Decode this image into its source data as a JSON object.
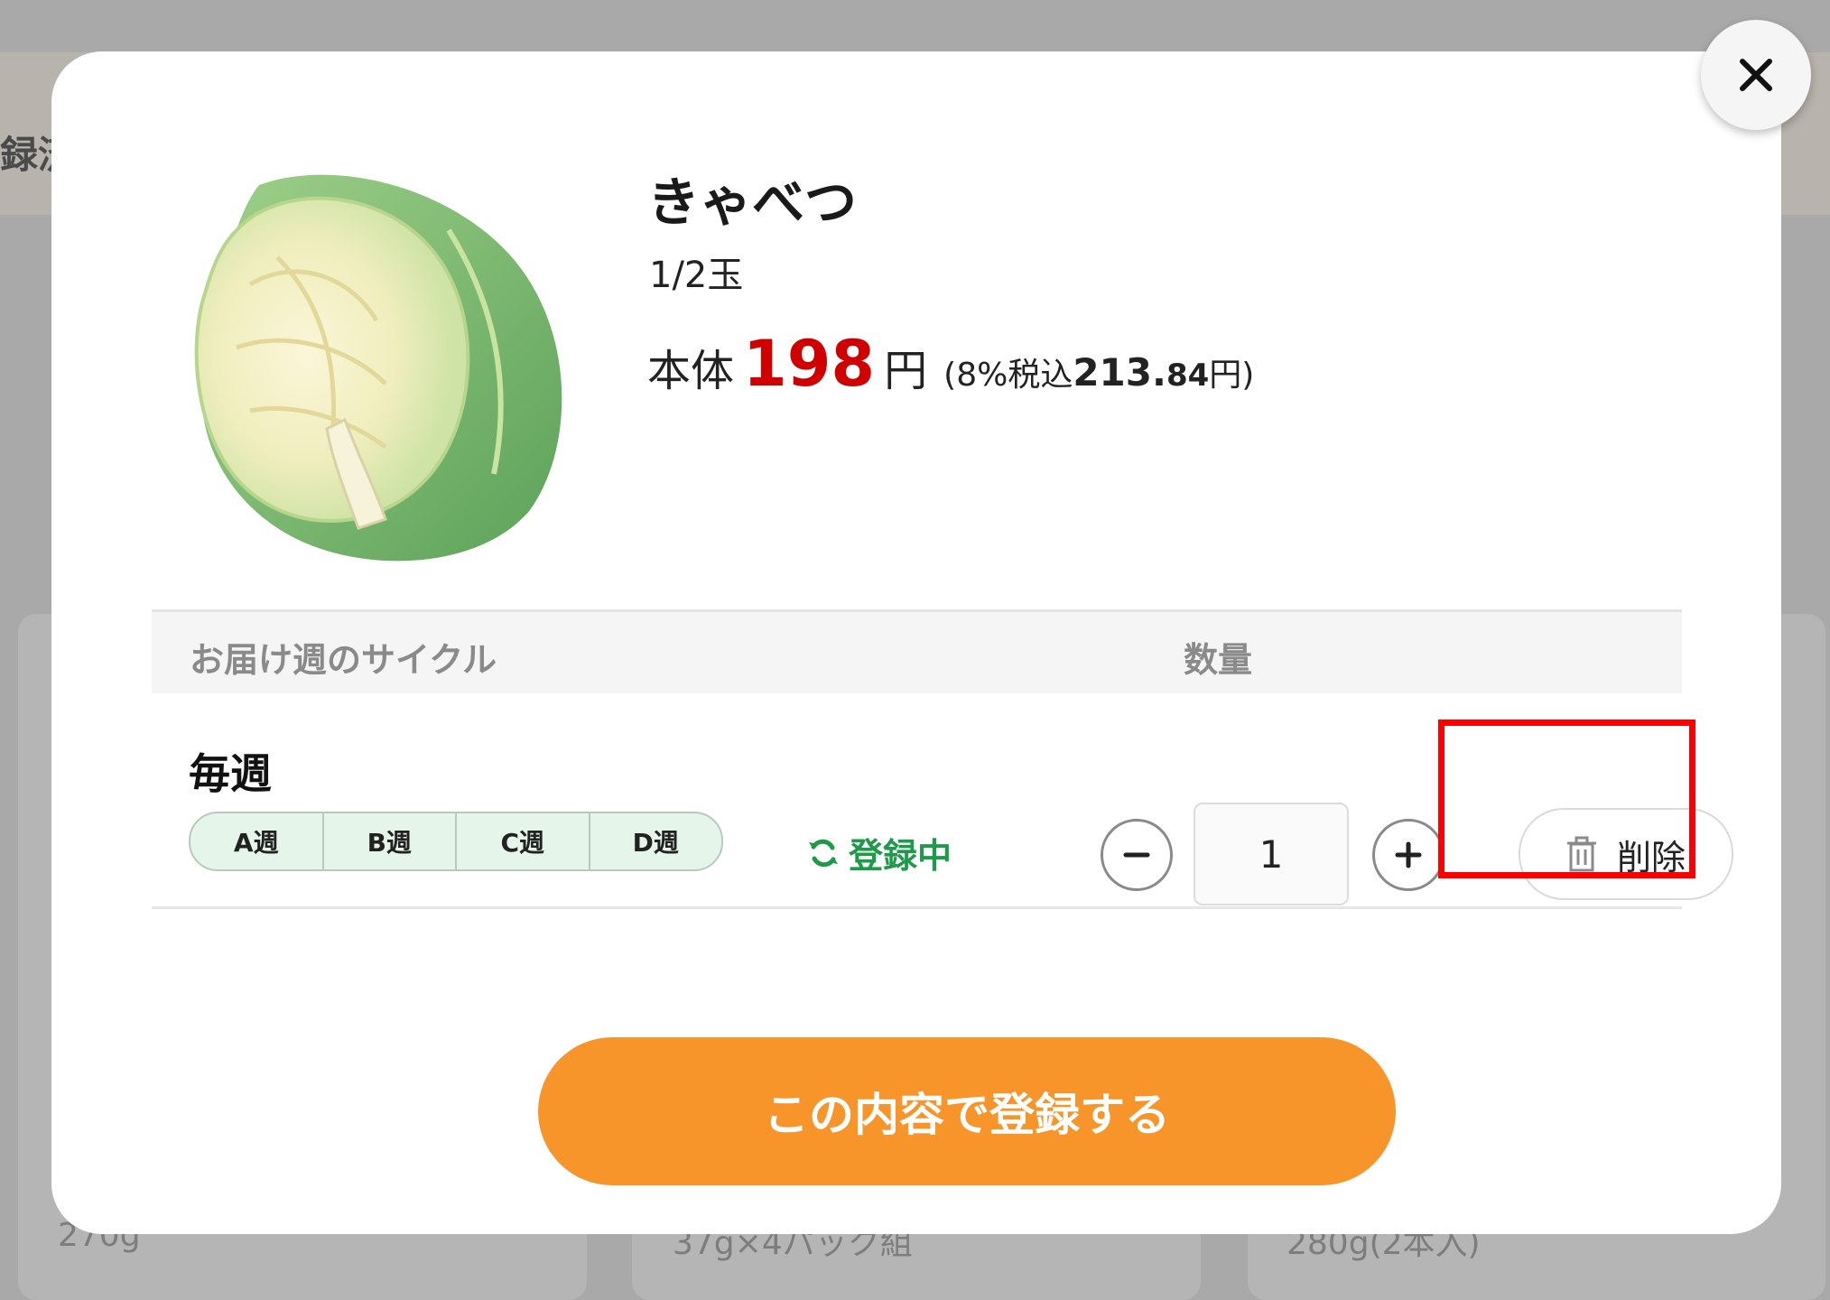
{
  "background": {
    "header_text": "録済",
    "cards": [
      "270g",
      "37g×4パック組",
      "280g(2本入)"
    ]
  },
  "modal": {
    "close_icon": "close-icon",
    "product": {
      "name": "きゃべつ",
      "size": "1/2玉",
      "price_label": "本体",
      "price_value": "198",
      "price_unit": "円",
      "tax_prefix": "(8%税込",
      "tax_value": "213.",
      "tax_decimal": "84",
      "tax_suffix": "円)"
    },
    "table": {
      "header_cycle": "お届け週のサイクル",
      "header_qty": "数量"
    },
    "row": {
      "cycle_title": "毎週",
      "weeks": [
        "A週",
        "B週",
        "C週",
        "D週"
      ],
      "status_icon": "refresh-icon",
      "status_text": "登録中",
      "quantity": "1",
      "delete_label": "削除",
      "delete_icon": "trash-icon"
    },
    "submit_label": "この内容で登録する"
  },
  "colors": {
    "accent_orange": "#f7952a",
    "price_red": "#d00000",
    "status_green": "#1e9a4a",
    "week_bg": "#e5f5ea",
    "highlight_red": "#ff0000"
  }
}
